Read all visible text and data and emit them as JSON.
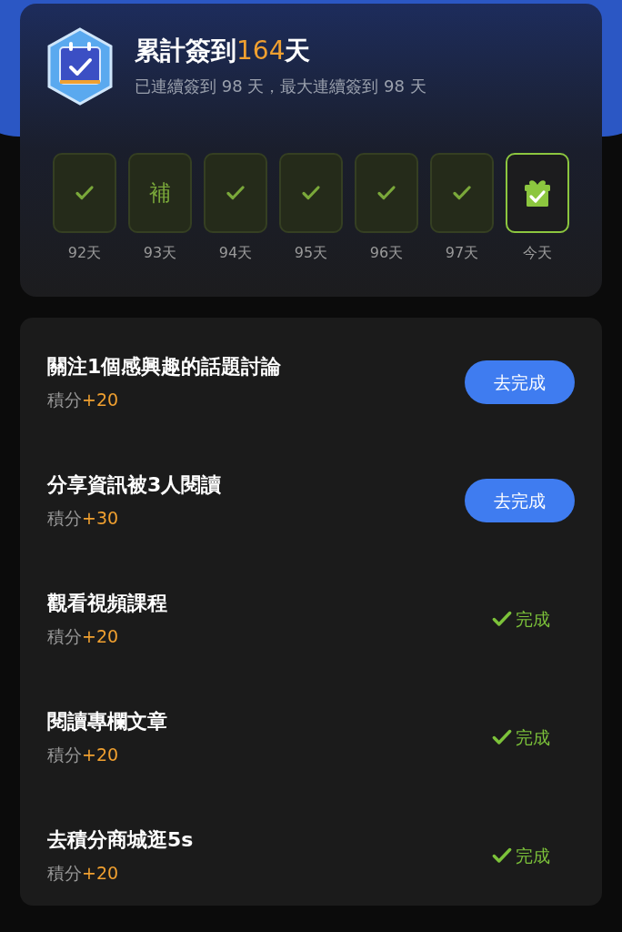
{
  "summary": {
    "title_prefix": "累計簽到",
    "title_count": "164",
    "title_suffix": "天",
    "subtitle": "已連續簽到 98 天，最大連續簽到 98 天"
  },
  "days": [
    {
      "kind": "checked",
      "label": "92天"
    },
    {
      "kind": "makeup",
      "mark": "補",
      "label": "93天"
    },
    {
      "kind": "checked",
      "label": "94天"
    },
    {
      "kind": "checked",
      "label": "95天"
    },
    {
      "kind": "checked",
      "label": "96天"
    },
    {
      "kind": "checked",
      "label": "97天"
    },
    {
      "kind": "today",
      "label": "今天"
    }
  ],
  "tasks": [
    {
      "title": "關注1個感興趣的話題討論",
      "points_label": "積分",
      "points": "+20",
      "kind": "todo",
      "action": "去完成"
    },
    {
      "title": "分享資訊被3人閱讀",
      "points_label": "積分",
      "points": "+30",
      "kind": "todo",
      "action": "去完成"
    },
    {
      "title": "觀看視頻課程",
      "points_label": "積分",
      "points": "+20",
      "kind": "done",
      "action": "完成"
    },
    {
      "title": "閱讀專欄文章",
      "points_label": "積分",
      "points": "+20",
      "kind": "done",
      "action": "完成"
    },
    {
      "title": "去積分商城逛5s",
      "points_label": "積分",
      "points": "+20",
      "kind": "done",
      "action": "完成"
    }
  ]
}
